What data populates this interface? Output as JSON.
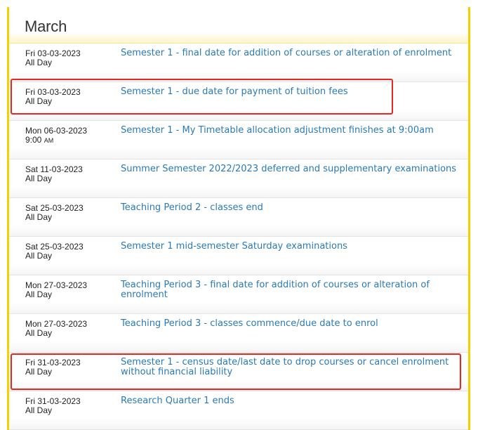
{
  "calendar": {
    "month": "March",
    "events": [
      {
        "date": "Fri 03-03-2023",
        "time": "All Day",
        "title": "Semester 1 - final date for addition of courses or alteration of enrolment"
      },
      {
        "date": "Fri 03-03-2023",
        "time": "All Day",
        "title": "Semester 1 - due date for payment of tuition fees"
      },
      {
        "date": "Mon 06-03-2023",
        "time": "9:00",
        "time_suffix": "AM",
        "title": "Semester 1 - My Timetable allocation adjustment finishes at 9:00am"
      },
      {
        "date": "Sat 11-03-2023",
        "time": "All Day",
        "title": "Summer Semester 2022/2023 deferred and supplementary examinations"
      },
      {
        "date": "Sat 25-03-2023",
        "time": "All Day",
        "title": "Teaching Period 2 - classes end"
      },
      {
        "date": "Sat 25-03-2023",
        "time": "All Day",
        "title": "Semester 1 mid-semester Saturday examinations"
      },
      {
        "date": "Mon 27-03-2023",
        "time": "All Day",
        "title": "Teaching Period 3 - final date for addition of courses or alteration of enrolment"
      },
      {
        "date": "Mon 27-03-2023",
        "time": "All Day",
        "title": "Teaching Period 3 - classes commence/due date to enrol"
      },
      {
        "date": "Fri 31-03-2023",
        "time": "All Day",
        "title": "Semester 1 - census date/last date to drop courses or cancel enrolment without financial liability"
      },
      {
        "date": "Fri 31-03-2023",
        "time": "All Day",
        "title": "Research Quarter 1 ends"
      }
    ]
  },
  "colors": {
    "panel_border": "#f5d000",
    "link": "#2a7ab9",
    "highlight_box": "#e8281f"
  }
}
